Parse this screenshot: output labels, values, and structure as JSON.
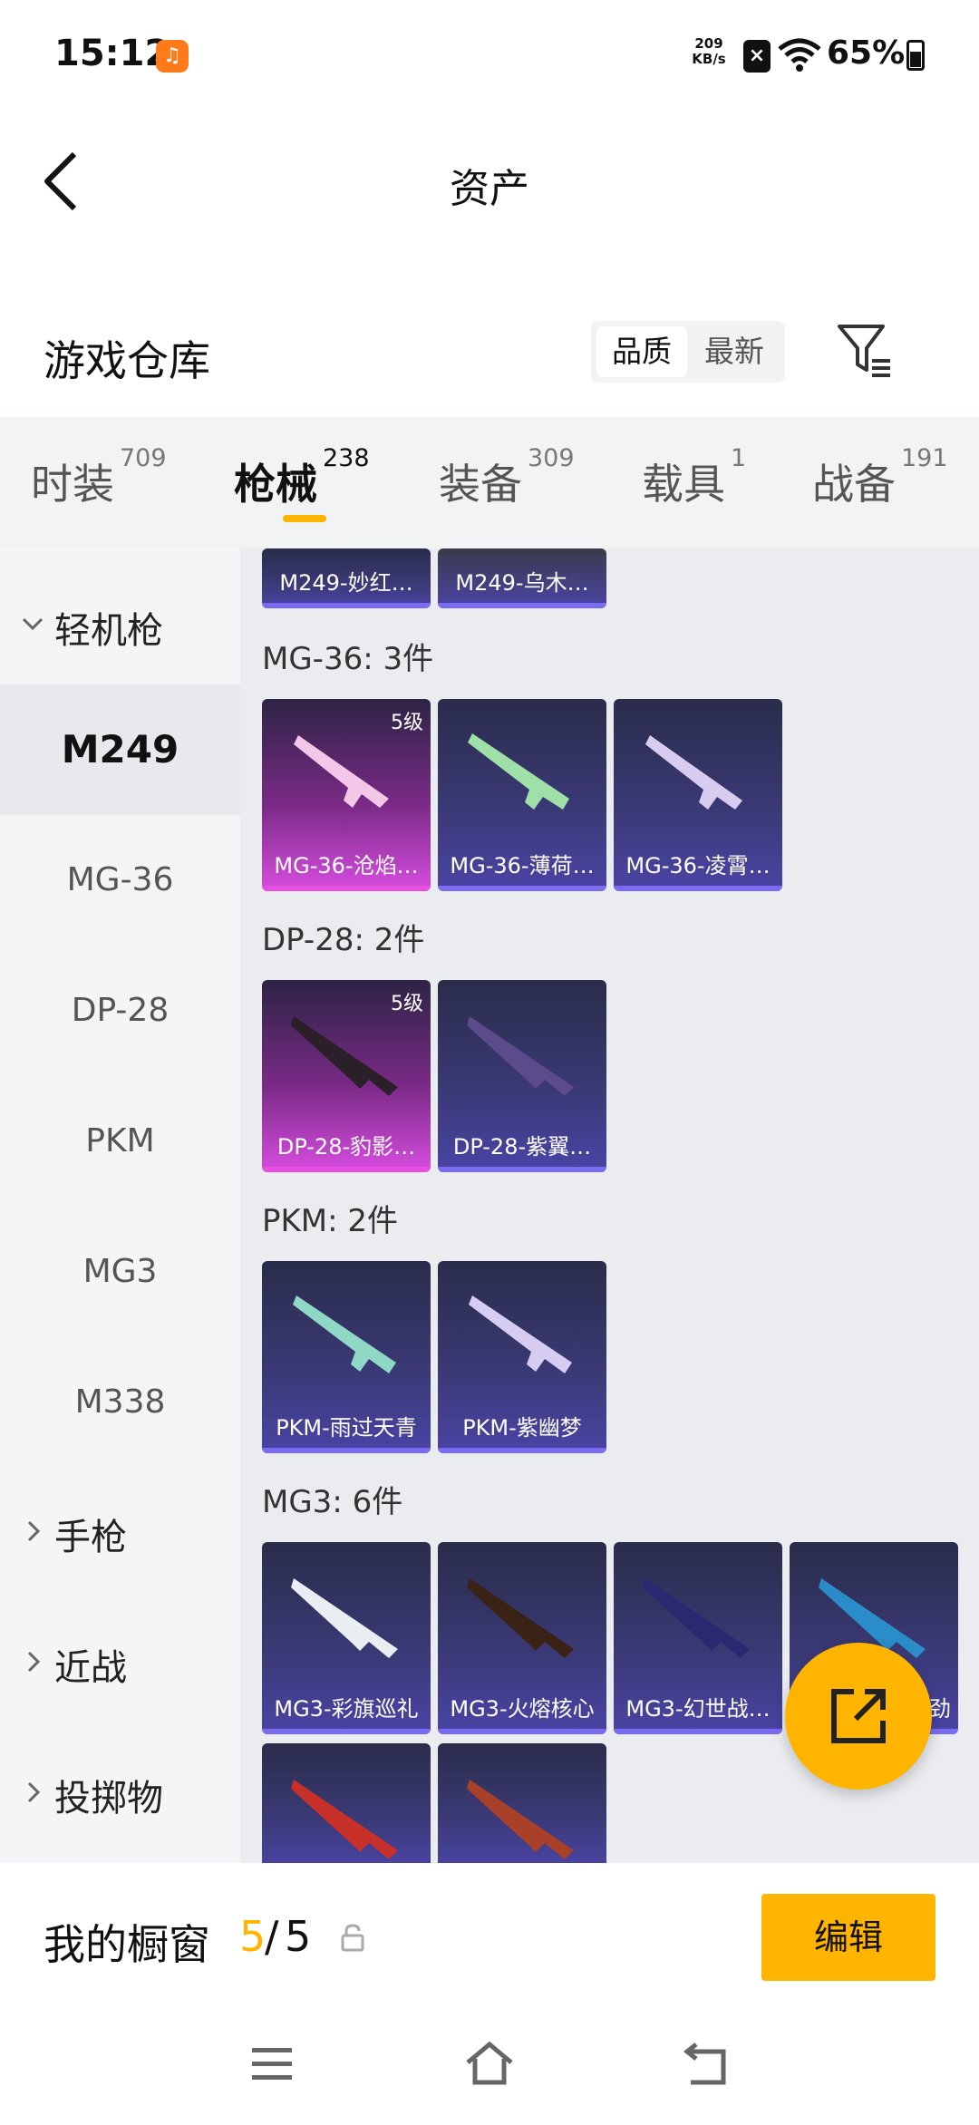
{
  "status_bar": {
    "time": "15:12",
    "app_badge": "♫",
    "net_speed_value": "209",
    "net_speed_unit": "KB/s",
    "battery": "65%"
  },
  "header": {
    "title": "资产"
  },
  "warehouse": {
    "title": "游戏仓库",
    "sort_options": [
      "品质",
      "最新"
    ],
    "selected_sort": "品质"
  },
  "tabs": [
    {
      "label": "时装",
      "count": "709"
    },
    {
      "label": "枪械",
      "count": "238",
      "active": true
    },
    {
      "label": "装备",
      "count": "309"
    },
    {
      "label": "载具",
      "count": "1"
    },
    {
      "label": "战备",
      "count": "191"
    }
  ],
  "sidebar": {
    "groups": [
      {
        "label": "轻机枪",
        "expanded": true
      },
      {
        "label": "手枪",
        "expanded": false
      },
      {
        "label": "近战",
        "expanded": false
      },
      {
        "label": "投掷物",
        "expanded": false
      }
    ],
    "items": [
      "M249",
      "MG-36",
      "DP-28",
      "PKM",
      "MG3",
      "M338"
    ],
    "active_item": "M249"
  },
  "sections": [
    {
      "title": "",
      "cards": [
        "M249-妙红…",
        "M249-乌木…"
      ]
    },
    {
      "title": "MG-36: 3件",
      "cards": [
        "MG-36-沧焰…",
        "MG-36-薄荷…",
        "MG-36-凌霄…"
      ],
      "level": "5级"
    },
    {
      "title": "DP-28: 2件",
      "cards": [
        "DP-28-豹影…",
        "DP-28-紫翼…"
      ],
      "level": "5级"
    },
    {
      "title": "PKM: 2件",
      "cards": [
        "PKM-雨过天青",
        "PKM-紫幽梦"
      ]
    },
    {
      "title": "MG3: 6件",
      "cards": [
        "MG3-彩旗巡礼",
        "MG3-火熔核心",
        "MG3-幻世战…",
        "劲"
      ]
    }
  ],
  "showcase": {
    "label": "我的橱窗",
    "current": "5",
    "separator": "/",
    "max": "5",
    "edit_label": "编辑"
  },
  "colors": {
    "accent": "#ffb400",
    "gold_card": "#d74de0",
    "blue_card": "#4a44a6"
  },
  "icons": [
    "back-icon",
    "filter-icon",
    "share-icon",
    "lock-icon",
    "menu-icon",
    "home-icon",
    "return-icon",
    "wifi-icon",
    "battery-icon"
  ]
}
